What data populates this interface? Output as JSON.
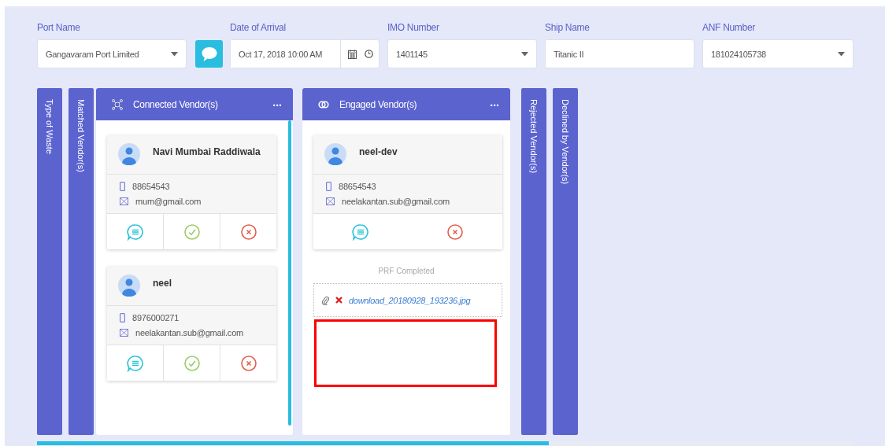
{
  "filters": [
    {
      "label": "Port Name",
      "kind": "select",
      "value": "Gangavaram Port Limited"
    },
    {
      "label": "Date of Arrival",
      "kind": "datetime",
      "value": "Oct 17, 2018 10:00 AM"
    },
    {
      "label": "IMO Number",
      "kind": "select",
      "value": "1401145"
    },
    {
      "label": "Ship Name",
      "kind": "text",
      "value": "Titanic II"
    },
    {
      "label": "ANF Number",
      "kind": "select",
      "value": "181024105738"
    }
  ],
  "left_tabs": [
    "Type of Waste",
    "Matched Vendor(s)"
  ],
  "connected": {
    "title": "Connected Vendor(s)",
    "menu": "...",
    "vendors": [
      {
        "name": "Navi Mumbai Raddiwala",
        "phone": "88654543",
        "email": "mum@gmail.com",
        "actions": [
          {
            "kind": "chat"
          },
          {
            "kind": "accept"
          },
          {
            "kind": "reject"
          }
        ]
      },
      {
        "name": "neel",
        "phone": "8976000271",
        "email": "neelakantan.sub@gmail.com",
        "actions": [
          {
            "kind": "chat"
          },
          {
            "kind": "accept"
          },
          {
            "kind": "reject"
          }
        ]
      }
    ]
  },
  "engaged": {
    "title": "Engaged Vendor(s)",
    "menu": "...",
    "vendors": [
      {
        "name": "neel-dev",
        "phone": "88654543",
        "email": "neelakantan.sub@gmail.com",
        "actions": [
          {
            "kind": "chat"
          },
          {
            "kind": "reject"
          }
        ]
      }
    ],
    "status": "PRF Completed",
    "attachment": "download_20180928_193236.jpg"
  },
  "right_tabs": [
    "Rejected Vendor(s)",
    "Declined by Vendor(s)"
  ]
}
